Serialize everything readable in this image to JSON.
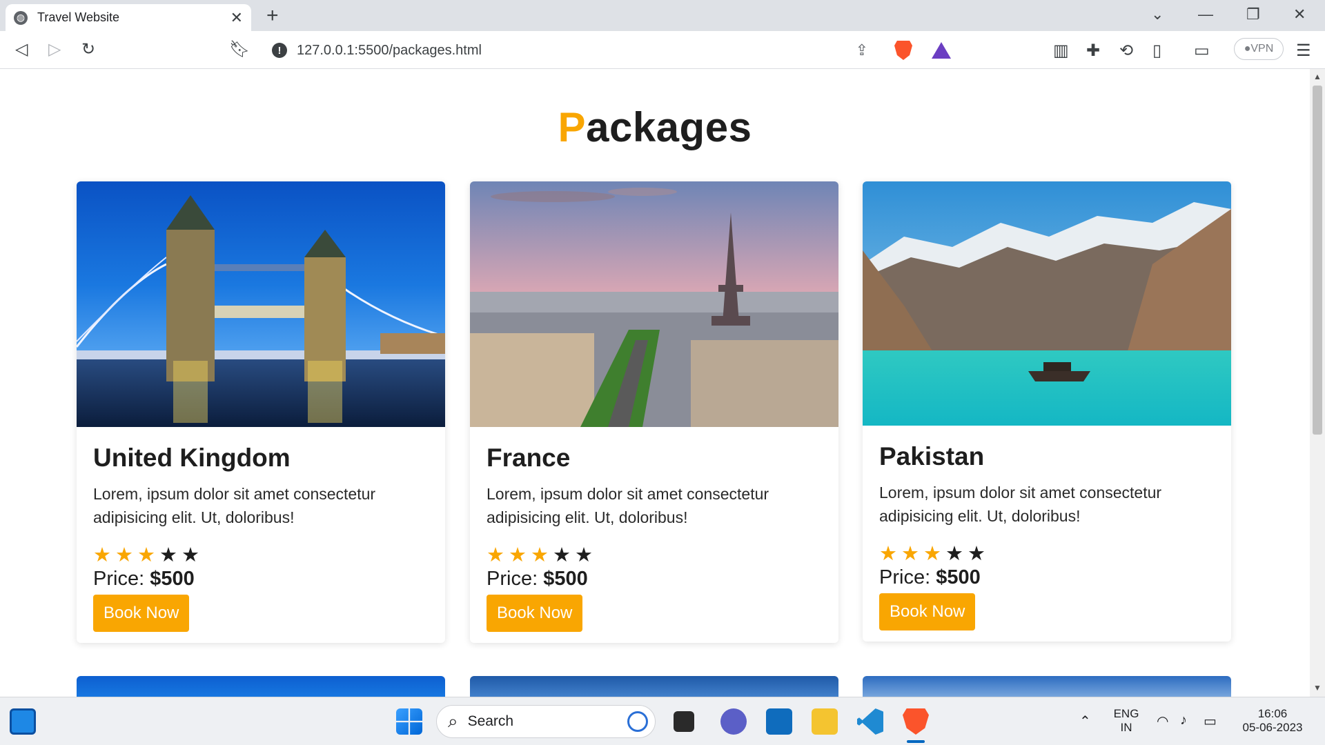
{
  "browser": {
    "tab_title": "Travel Website",
    "url": "127.0.0.1:5500/packages.html",
    "vpn_label": "VPN"
  },
  "page": {
    "heading_first": "P",
    "heading_rest": "ackages",
    "packages": [
      {
        "name": "United Kingdom",
        "desc": "Lorem, ipsum dolor sit amet consectetur adipisicing elit. Ut, doloribus!",
        "rating": 3,
        "max": 5,
        "price_label": "Price:",
        "price": "$500",
        "button": "Book Now"
      },
      {
        "name": "France",
        "desc": "Lorem, ipsum dolor sit amet consectetur adipisicing elit. Ut, doloribus!",
        "rating": 3,
        "max": 5,
        "price_label": "Price:",
        "price": "$500",
        "button": "Book Now"
      },
      {
        "name": "Pakistan",
        "desc": "Lorem, ipsum dolor sit amet consectetur adipisicing elit. Ut, doloribus!",
        "rating": 3,
        "max": 5,
        "price_label": "Price:",
        "price": "$500",
        "button": "Book Now"
      }
    ]
  },
  "taskbar": {
    "search_label": "Search",
    "lang_top": "ENG",
    "lang_bottom": "IN",
    "time": "16:06",
    "date": "05-06-2023"
  },
  "colors": {
    "accent": "#f9a602",
    "text": "#1e1e1e"
  }
}
